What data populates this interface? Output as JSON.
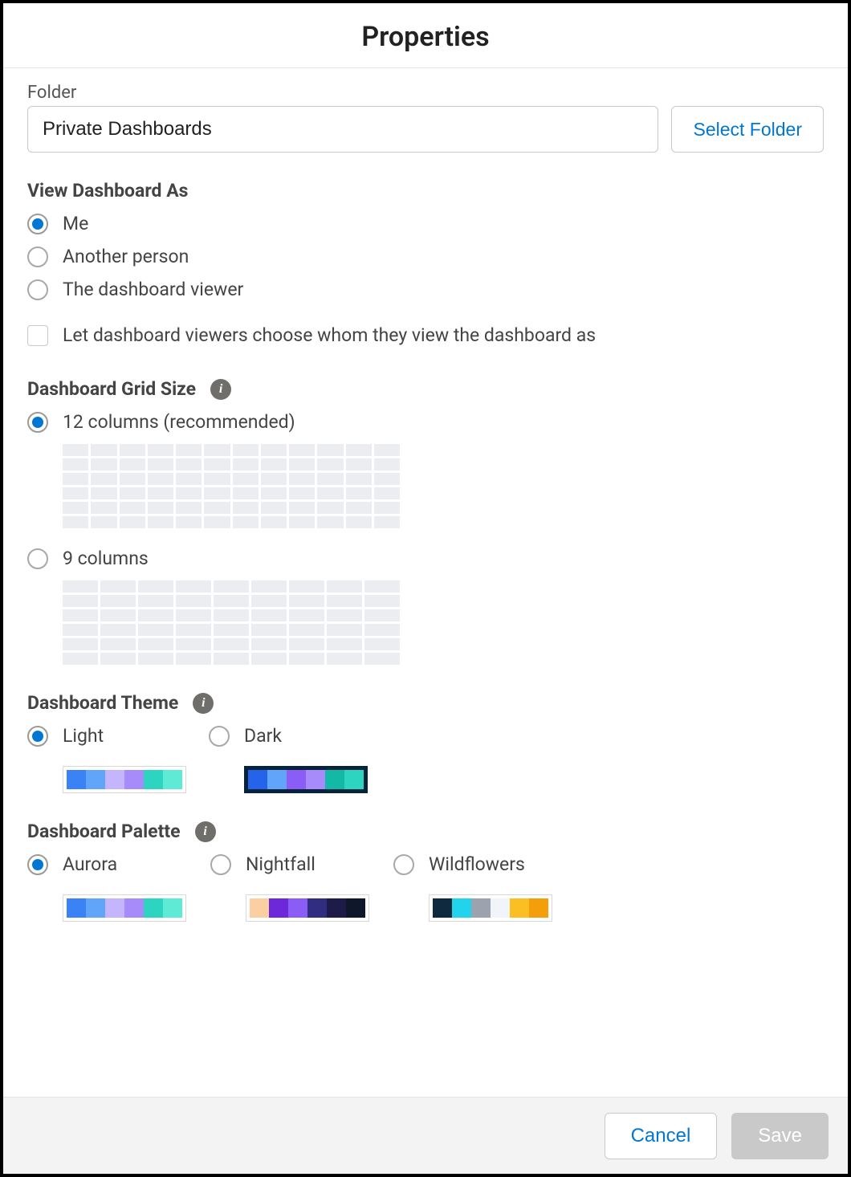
{
  "header": {
    "title": "Properties"
  },
  "folder": {
    "label": "Folder",
    "value": "Private Dashboards",
    "select_button": "Select Folder"
  },
  "view_as": {
    "heading": "View Dashboard As",
    "options": {
      "me": "Me",
      "another": "Another person",
      "viewer": "The dashboard viewer"
    },
    "selected": "me",
    "checkbox_label": "Let dashboard viewers choose whom they view the dashboard as",
    "checkbox_checked": false
  },
  "grid_size": {
    "heading": "Dashboard Grid Size",
    "options": {
      "twelve": "12 columns (recommended)",
      "nine": "9 columns"
    },
    "selected": "twelve"
  },
  "theme": {
    "heading": "Dashboard Theme",
    "options": {
      "light": "Light",
      "dark": "Dark"
    },
    "selected": "light",
    "swatches": {
      "light": [
        "#3b82f6",
        "#60a5fa",
        "#c4b5fd",
        "#a78bfa",
        "#2dd4bf",
        "#5eead4"
      ],
      "dark": [
        "#2563eb",
        "#60a5fa",
        "#8b5cf6",
        "#a78bfa",
        "#14b8a6",
        "#2dd4bf"
      ]
    }
  },
  "palette": {
    "heading": "Dashboard Palette",
    "options": {
      "aurora": "Aurora",
      "nightfall": "Nightfall",
      "wildflowers": "Wildflowers"
    },
    "selected": "aurora",
    "swatches": {
      "aurora": [
        "#3b82f6",
        "#60a5fa",
        "#c4b5fd",
        "#a78bfa",
        "#2dd4bf",
        "#5eead4"
      ],
      "nightfall": [
        "#fbcfa2",
        "#6d28d9",
        "#8b5cf6",
        "#312e81",
        "#1e1b4b",
        "#0f172a"
      ],
      "wildflowers": [
        "#0f2a3f",
        "#22d3ee",
        "#9ca3af",
        "#f1f5f9",
        "#fbbf24",
        "#f59e0b"
      ]
    }
  },
  "footer": {
    "cancel": "Cancel",
    "save": "Save"
  }
}
